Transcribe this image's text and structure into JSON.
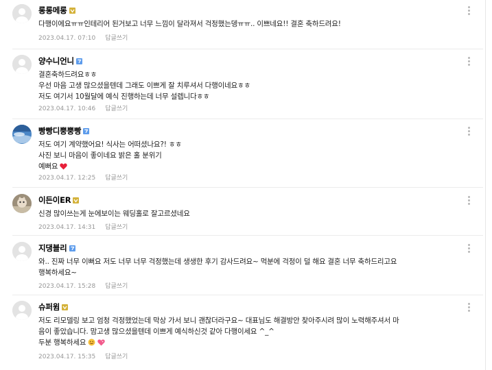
{
  "comments": [
    {
      "nickname": "롱롱메롱",
      "badge": "gold",
      "lines": [
        "다행이에요ㅠㅠ인테리어 된거보고 너무 느낌이 달라져서 걱정했는뎅ㅠㅠ.. 이쁘네요!! 결혼 축하드려요!"
      ],
      "date": "2023.04.17. 07:10",
      "reply_label": "답글쓰기"
    },
    {
      "nickname": "양수니언니",
      "badge": "blue",
      "lines": [
        "결혼축하드려요ㅎㅎ",
        "우선 마음 고생 많으셨을텐데 그래도 이쁘게 잘 치루셔서 다행이네요ㅎㅎ",
        "저도 여기서 10월달에 예식 진행하는데 너무 설렙니다ㅎㅎ"
      ],
      "date": "2023.04.17. 10:46",
      "reply_label": "답글쓰기"
    },
    {
      "nickname": "빵빵디뿡뿡빵",
      "badge": "blue",
      "lines": [
        "저도 여기 계약했어요! 식사는 어떠셨나요?! ㅎㅎ",
        "사진 보니 마음이 좋이네요 밝은 홀 분위기",
        "예뻐요"
      ],
      "last_line_emoji": "heart",
      "date": "2023.04.17. 12:25",
      "reply_label": "답글쓰기"
    },
    {
      "nickname": "이든이ER",
      "badge": "gold",
      "lines": [
        "신경 많이쓰는게 눈에보이는 웨딩홀로 잘고르셨네요"
      ],
      "date": "2023.04.17. 14:31",
      "reply_label": "답글쓰기"
    },
    {
      "nickname": "지댕블리",
      "badge": "blue",
      "lines": [
        "와.. 진짜 너무 이뻐요 저도 너무 너무 걱정했는데 생생한 후기 감사드려요~ 먹분에 걱정이 덜 해요 결혼 너무 축하드리고요",
        "행복하세요~"
      ],
      "date": "2023.04.17. 15:28",
      "reply_label": "답글쓰기"
    },
    {
      "nickname": "슈퍼윔",
      "badge": "gold",
      "lines": [
        "저도 리모델링 보고 엄청 걱정했었는데 막상 가서 보니 괜찮더라구요~ 대표님도 해결방안 찾아주시려 많이 노력해주셔서 마",
        "음이 좋았습니다. 맘고생 많으셨을텐데 이쁘게 예식하신것 같아 다행이세요 ^_^",
        "두분 행복하세요"
      ],
      "last_line_emoji": "smile-heart",
      "date": "2023.04.17. 15:35",
      "reply_label": "답글쓰기"
    }
  ],
  "colors": {
    "gold_badge": "#d4b23a",
    "blue_badge": "#5d9cec",
    "heart": "#e8203a",
    "meta_text": "#979797"
  }
}
